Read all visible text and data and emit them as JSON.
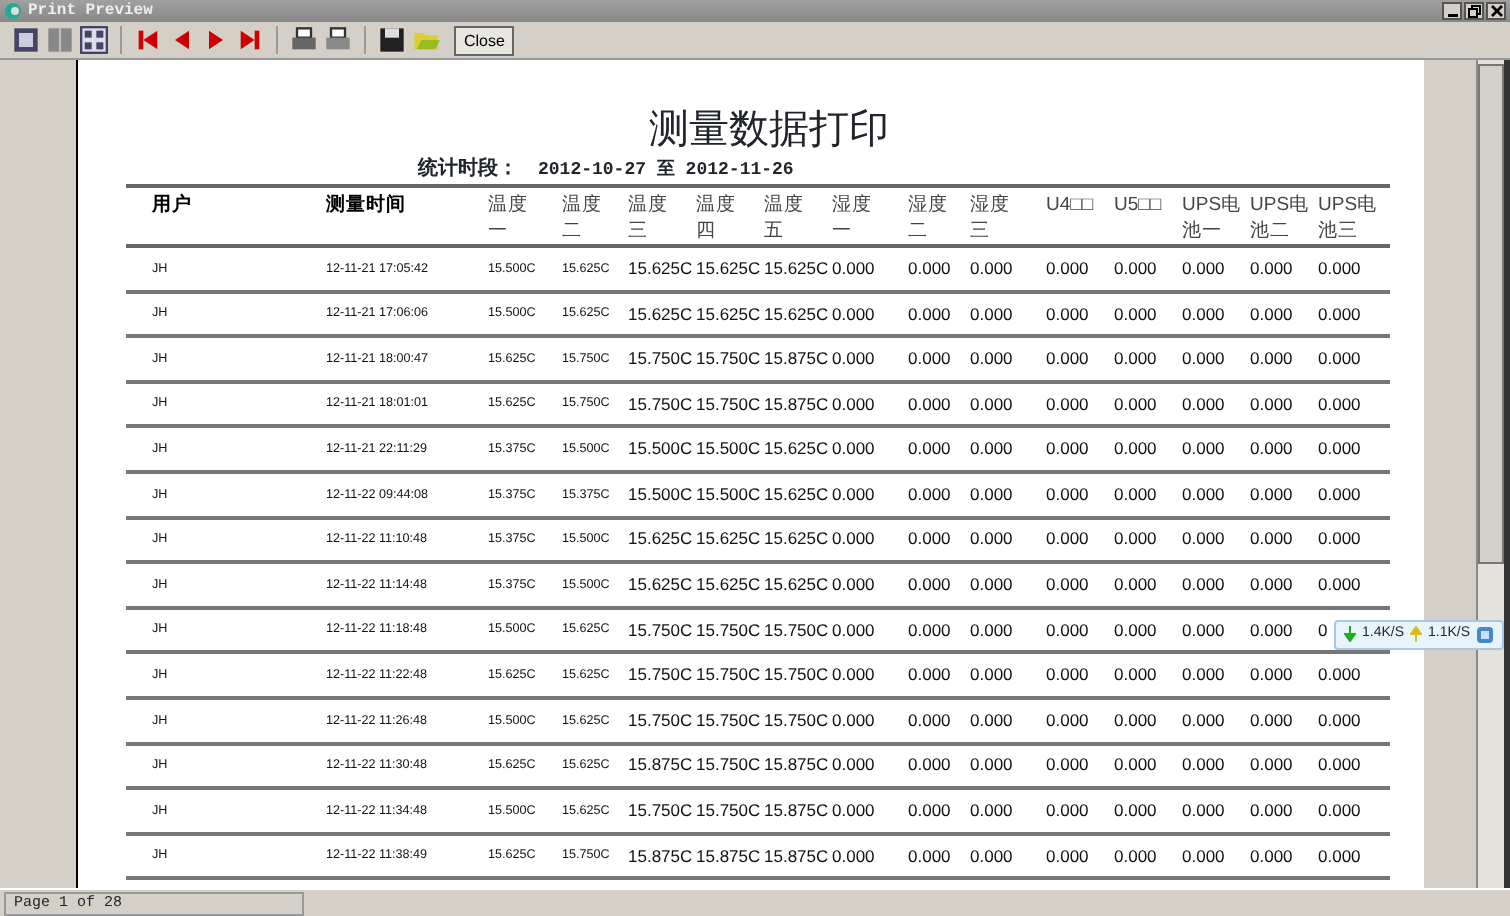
{
  "window": {
    "title": "Print Preview"
  },
  "toolbar": {
    "close_button": "Close"
  },
  "report": {
    "title": "测量数据打印",
    "period_label": "统计时段：",
    "period_value": "2012-10-27 至 2012-11-26",
    "columns": [
      "用户",
      "测量时间",
      "温度一",
      "温度二",
      "温度三",
      "温度四",
      "温度五",
      "湿度一",
      "湿度二",
      "湿度三",
      "U4□□",
      "U5□□",
      "UPS电池一",
      "UPS电池二",
      "UPS电池三"
    ],
    "rows": [
      {
        "user": "JH",
        "time": "12-11-21 17:05:42",
        "values": [
          "15.500C",
          "15.625C",
          "15.625C",
          "15.625C",
          "15.625C",
          "0.000",
          "0.000",
          "0.000",
          "0.000",
          "0.000",
          "0.000",
          "0.000",
          "0.000"
        ]
      },
      {
        "user": "JH",
        "time": "12-11-21 17:06:06",
        "values": [
          "15.500C",
          "15.625C",
          "15.625C",
          "15.625C",
          "15.625C",
          "0.000",
          "0.000",
          "0.000",
          "0.000",
          "0.000",
          "0.000",
          "0.000",
          "0.000"
        ]
      },
      {
        "user": "JH",
        "time": "12-11-21 18:00:47",
        "values": [
          "15.625C",
          "15.750C",
          "15.750C",
          "15.750C",
          "15.875C",
          "0.000",
          "0.000",
          "0.000",
          "0.000",
          "0.000",
          "0.000",
          "0.000",
          "0.000"
        ]
      },
      {
        "user": "JH",
        "time": "12-11-21 18:01:01",
        "values": [
          "15.625C",
          "15.750C",
          "15.750C",
          "15.750C",
          "15.875C",
          "0.000",
          "0.000",
          "0.000",
          "0.000",
          "0.000",
          "0.000",
          "0.000",
          "0.000"
        ]
      },
      {
        "user": "JH",
        "time": "12-11-21 22:11:29",
        "values": [
          "15.375C",
          "15.500C",
          "15.500C",
          "15.500C",
          "15.625C",
          "0.000",
          "0.000",
          "0.000",
          "0.000",
          "0.000",
          "0.000",
          "0.000",
          "0.000"
        ]
      },
      {
        "user": "JH",
        "time": "12-11-22 09:44:08",
        "values": [
          "15.375C",
          "15.375C",
          "15.500C",
          "15.500C",
          "15.625C",
          "0.000",
          "0.000",
          "0.000",
          "0.000",
          "0.000",
          "0.000",
          "0.000",
          "0.000"
        ]
      },
      {
        "user": "JH",
        "time": "12-11-22 11:10:48",
        "values": [
          "15.375C",
          "15.500C",
          "15.625C",
          "15.625C",
          "15.625C",
          "0.000",
          "0.000",
          "0.000",
          "0.000",
          "0.000",
          "0.000",
          "0.000",
          "0.000"
        ]
      },
      {
        "user": "JH",
        "time": "12-11-22 11:14:48",
        "values": [
          "15.375C",
          "15.500C",
          "15.625C",
          "15.625C",
          "15.625C",
          "0.000",
          "0.000",
          "0.000",
          "0.000",
          "0.000",
          "0.000",
          "0.000",
          "0.000"
        ]
      },
      {
        "user": "JH",
        "time": "12-11-22 11:18:48",
        "values": [
          "15.500C",
          "15.625C",
          "15.750C",
          "15.750C",
          "15.750C",
          "0.000",
          "0.000",
          "0.000",
          "0.000",
          "0.000",
          "0.000",
          "0.000",
          "0"
        ]
      },
      {
        "user": "JH",
        "time": "12-11-22 11:22:48",
        "values": [
          "15.625C",
          "15.625C",
          "15.750C",
          "15.750C",
          "15.750C",
          "0.000",
          "0.000",
          "0.000",
          "0.000",
          "0.000",
          "0.000",
          "0.000",
          "0.000"
        ]
      },
      {
        "user": "JH",
        "time": "12-11-22 11:26:48",
        "values": [
          "15.500C",
          "15.625C",
          "15.750C",
          "15.750C",
          "15.750C",
          "0.000",
          "0.000",
          "0.000",
          "0.000",
          "0.000",
          "0.000",
          "0.000",
          "0.000"
        ]
      },
      {
        "user": "JH",
        "time": "12-11-22 11:30:48",
        "values": [
          "15.625C",
          "15.625C",
          "15.875C",
          "15.750C",
          "15.875C",
          "0.000",
          "0.000",
          "0.000",
          "0.000",
          "0.000",
          "0.000",
          "0.000",
          "0.000"
        ]
      },
      {
        "user": "JH",
        "time": "12-11-22 11:34:48",
        "values": [
          "15.500C",
          "15.625C",
          "15.750C",
          "15.750C",
          "15.875C",
          "0.000",
          "0.000",
          "0.000",
          "0.000",
          "0.000",
          "0.000",
          "0.000",
          "0.000"
        ]
      },
      {
        "user": "JH",
        "time": "12-11-22 11:38:49",
        "values": [
          "15.625C",
          "15.750C",
          "15.875C",
          "15.875C",
          "15.875C",
          "0.000",
          "0.000",
          "0.000",
          "0.000",
          "0.000",
          "0.000",
          "0.000",
          "0.000"
        ]
      }
    ]
  },
  "status_bar": {
    "page": "Page 1 of 28"
  },
  "speed_widget": {
    "download": "1.4K/S",
    "upload": "1.1K/S"
  }
}
